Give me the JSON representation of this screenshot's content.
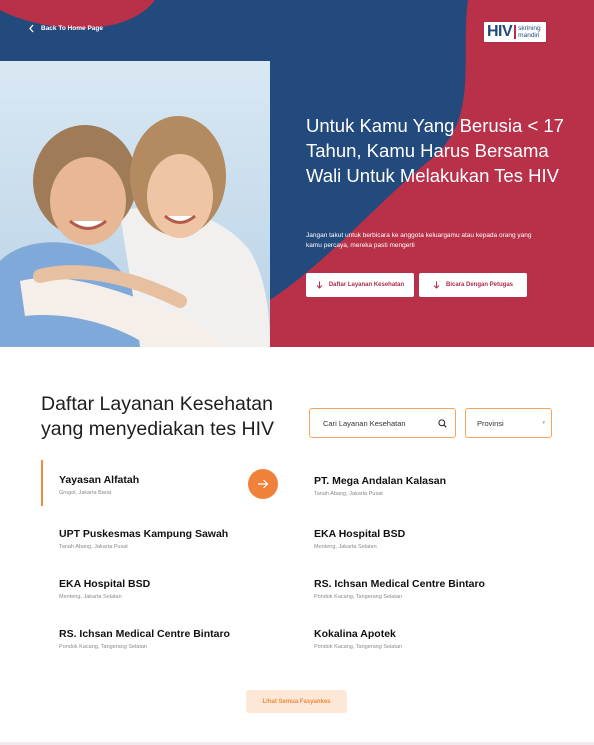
{
  "header": {
    "back_label": "Back To Home Page",
    "logo_main": "HIV",
    "logo_sub_1": "skrining",
    "logo_sub_2": "mandiri"
  },
  "hero": {
    "title": "Untuk Kamu Yang Berusia < 17 Tahun, Kamu Harus Bersama Wali Untuk Melakukan Tes HIV",
    "subtitle": "Jangan takut untuk berbicara ke anggota keluargamu atau kepada orang yang kamu percaya, mereka pasti mengerti",
    "button_1": "Daftar Layanan Kesehatan",
    "button_2": "Bicara Dengan Petugas"
  },
  "section": {
    "title": "Daftar Layanan Kesehatan yang menyediakan tes HIV",
    "search_placeholder": "Cari Layanan Kesehatan",
    "province_label": "Provinsi",
    "view_all": "Lihat Semua Fasyankes"
  },
  "services": [
    {
      "name": "Yayasan Alfatah",
      "location": "Grogol, Jakarta Barat"
    },
    {
      "name": "PT. Mega Andalan Kalasan",
      "location": "Tanah Abang, Jakarta Pusat"
    },
    {
      "name": "UPT Puskesmas Kampung Sawah",
      "location": "Tanah Abang, Jakarta Pusat"
    },
    {
      "name": "EKA Hospital BSD",
      "location": "Menteng, Jakarta Selatan"
    },
    {
      "name": "EKA Hospital BSD",
      "location": "Menteng, Jakarta Selatan"
    },
    {
      "name": "RS. Ichsan Medical Centre Bintaro",
      "location": "Pondok Kacang, Tangerang Selatan"
    },
    {
      "name": "RS. Ichsan Medical Centre Bintaro",
      "location": "Pondok Kacang, Tangerang Selatan"
    },
    {
      "name": "Kokalina Apotek",
      "location": "Pondok Kacang, Tangerang Selatan"
    }
  ],
  "colors": {
    "navy": "#234a7c",
    "crimson": "#b83149",
    "accent_orange": "#f0813b"
  }
}
